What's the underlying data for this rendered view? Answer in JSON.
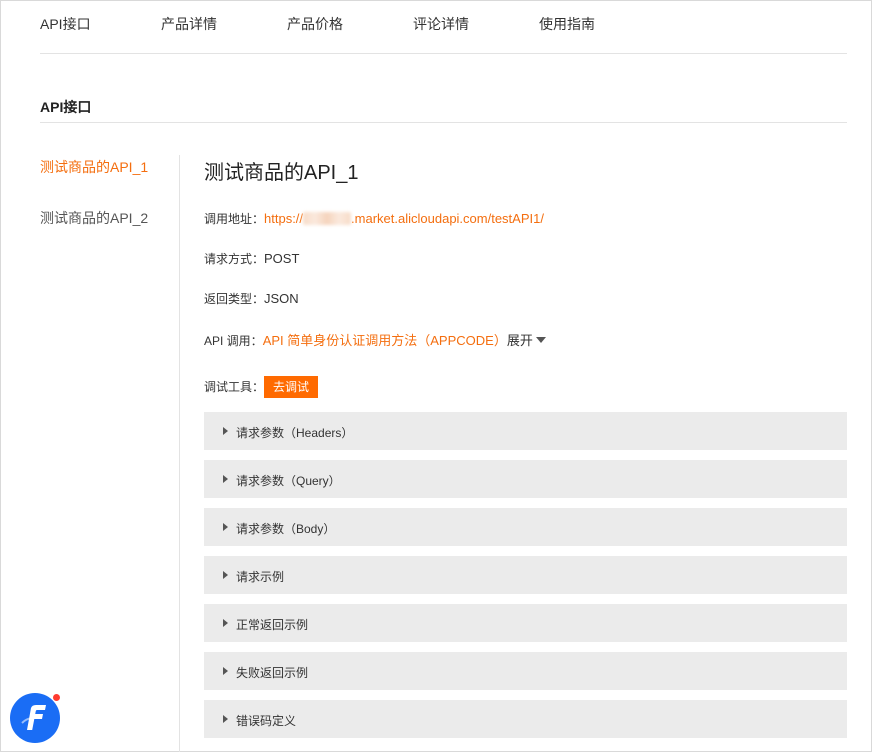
{
  "top_tabs": [
    {
      "label": "API接口"
    },
    {
      "label": "产品详情"
    },
    {
      "label": "产品价格"
    },
    {
      "label": "评论详情"
    },
    {
      "label": "使用指南"
    }
  ],
  "section": {
    "title": "API接口"
  },
  "sidebar": {
    "items": [
      {
        "label": "测试商品的API_1",
        "active": true
      },
      {
        "label": "测试商品的API_2",
        "active": false
      }
    ]
  },
  "api": {
    "title": "测试商品的API_1",
    "address_label": "调用地址：",
    "address_prefix": "https://",
    "address_suffix": ".market.alicloudapi.com/testAPI1/",
    "method_label": "请求方式：",
    "method_value": "POST",
    "return_label": "返回类型：",
    "return_value": "JSON",
    "call_label": "API 调用：",
    "call_link": "API 简单身份认证调用方法（APPCODE）",
    "expand_label": "展开",
    "debug_label": "调试工具：",
    "debug_button": "去调试"
  },
  "accordions": [
    {
      "label": "请求参数（Headers）"
    },
    {
      "label": "请求参数（Query）"
    },
    {
      "label": "请求参数（Body）"
    },
    {
      "label": "请求示例"
    },
    {
      "label": "正常返回示例"
    },
    {
      "label": "失败返回示例"
    },
    {
      "label": "错误码定义"
    }
  ],
  "colors": {
    "accent": "#f46e0f",
    "button": "#ff6a00",
    "accordion_bg": "#ebebeb",
    "logo_blue": "#1a6df5",
    "notification_red": "#ff3b30"
  },
  "icons": {
    "expand_caret": "caret-down-icon",
    "accordion_arrow": "caret-right-icon",
    "logo": "app-logo-icon",
    "badge": "notification-dot-icon"
  }
}
